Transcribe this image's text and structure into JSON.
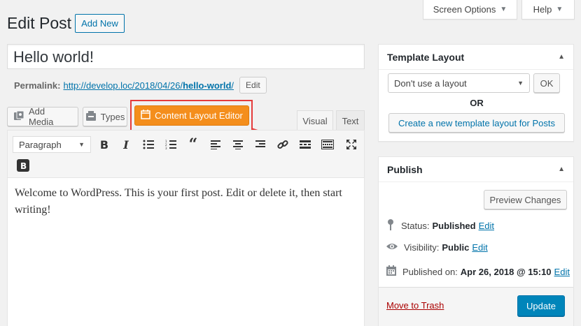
{
  "top": {
    "screen_options": "Screen Options",
    "help": "Help"
  },
  "header": {
    "title": "Edit Post",
    "add_new": "Add New"
  },
  "post": {
    "title": "Hello world!",
    "permalink_label": "Permalink:",
    "permalink_base": "http://develop.loc/2018/04/26/",
    "permalink_slug": "hello-world",
    "permalink_end": "/",
    "permalink_edit": "Edit"
  },
  "editor": {
    "add_media": "Add Media",
    "types": "Types",
    "content_layout_editor": "Content Layout Editor",
    "tab_visual": "Visual",
    "tab_text": "Text",
    "format": "Paragraph",
    "content": "Welcome to WordPress. This is your first post. Edit or delete it, then start writing!"
  },
  "template_layout": {
    "title": "Template Layout",
    "select": "Don't use a layout",
    "ok": "OK",
    "or": "OR",
    "create": "Create a new template layout for Posts"
  },
  "publish": {
    "title": "Publish",
    "preview": "Preview Changes",
    "status_label": "Status:",
    "status_value": "Published",
    "visibility_label": "Visibility:",
    "visibility_value": "Public",
    "published_label": "Published on:",
    "published_value": "Apr 26, 2018 @ 15:10",
    "edit": "Edit",
    "trash": "Move to Trash",
    "update": "Update"
  },
  "colors": {
    "accent": "#0085ba",
    "highlight": "#e53b3b",
    "cle": "#f48e1c"
  }
}
